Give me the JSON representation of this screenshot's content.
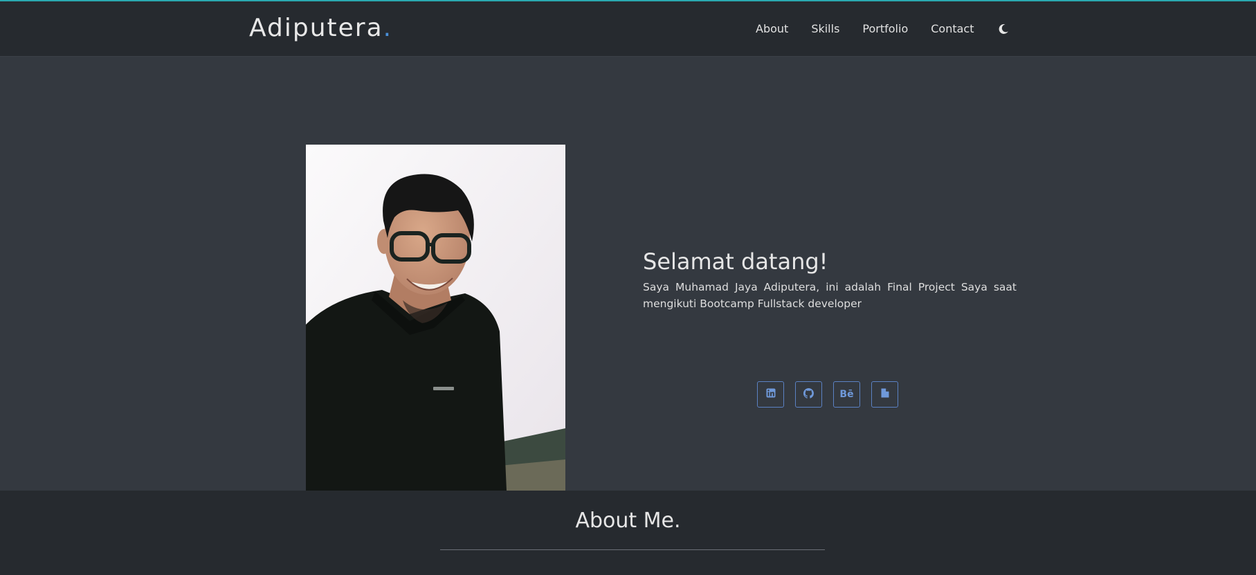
{
  "navbar": {
    "brand": "Adiputera",
    "brand_dot": ".",
    "links": [
      {
        "label": "About"
      },
      {
        "label": "Skills"
      },
      {
        "label": "Portfolio"
      },
      {
        "label": "Contact"
      }
    ],
    "theme_toggle_icon": "moon-icon"
  },
  "hero": {
    "photo_alt": "profile-photo",
    "title": "Selamat datang!",
    "description": "Saya Muhamad Jaya Adiputera, ini adalah Final Project Saya saat mengikuti Bootcamp Fullstack developer",
    "social": [
      {
        "icon": "linkedin-icon"
      },
      {
        "icon": "github-icon"
      },
      {
        "icon": "behance-icon",
        "label": "Bē"
      },
      {
        "icon": "document-icon"
      }
    ]
  },
  "about": {
    "title": "About Me."
  },
  "colors": {
    "accent": "#2aa8b0",
    "brand_dot": "#4a90d9",
    "navbar_bg": "#262a2f",
    "hero_bg": "#343940",
    "social_blue": "#6f99da"
  }
}
